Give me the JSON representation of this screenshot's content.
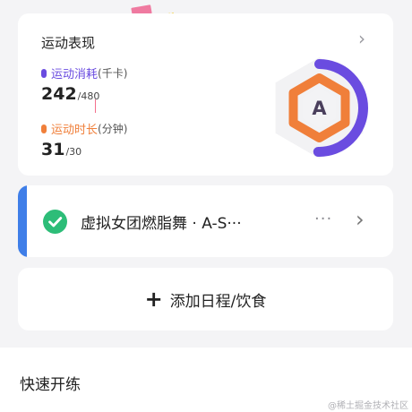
{
  "stats_card": {
    "title": "运动表现",
    "calories": {
      "label": "运动消耗",
      "unit": "(千卡)",
      "value": "242",
      "target": "/480",
      "progress": 0.504,
      "color": "#6a4ce0"
    },
    "duration": {
      "label": "运动时长",
      "unit": "(分钟)",
      "value": "31",
      "target": "/30",
      "progress": 1.0,
      "color": "#f07f3a"
    },
    "grade": "A"
  },
  "schedule_card": {
    "title": "虚拟女团燃脂舞 · A-S···",
    "more": "···",
    "accent": "#3f7ee8",
    "done_color": "#2dbd78"
  },
  "add_card": {
    "plus": "+",
    "label": "添加日程/饮食"
  },
  "quick_start": {
    "title": "快速开练"
  },
  "watermark": "@稀土掘金技术社区"
}
